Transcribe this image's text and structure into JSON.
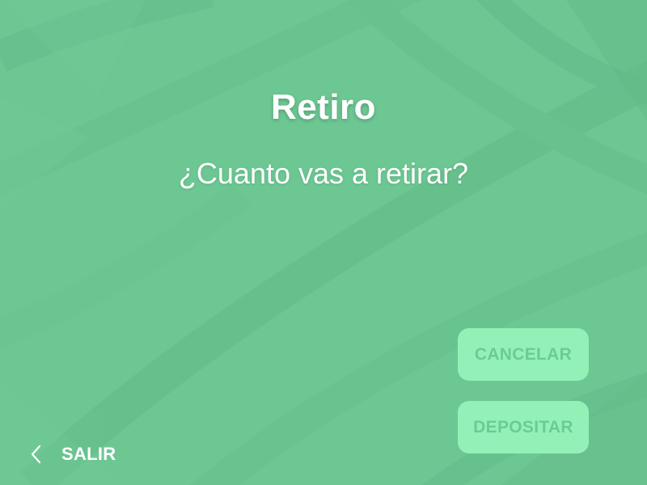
{
  "screen": {
    "title": "Retiro",
    "prompt": "¿Cuanto vas a retirar?"
  },
  "actions": {
    "cancel_label": "CANCELAR",
    "deposit_label": "DEPOSITAR"
  },
  "navigation": {
    "exit_label": "SALIR",
    "exit_icon": "chevron-left-icon"
  },
  "colors": {
    "background": "#6cc793",
    "button_background": "#93f1b8",
    "button_text": "#6ccb93",
    "text": "#ffffff"
  }
}
